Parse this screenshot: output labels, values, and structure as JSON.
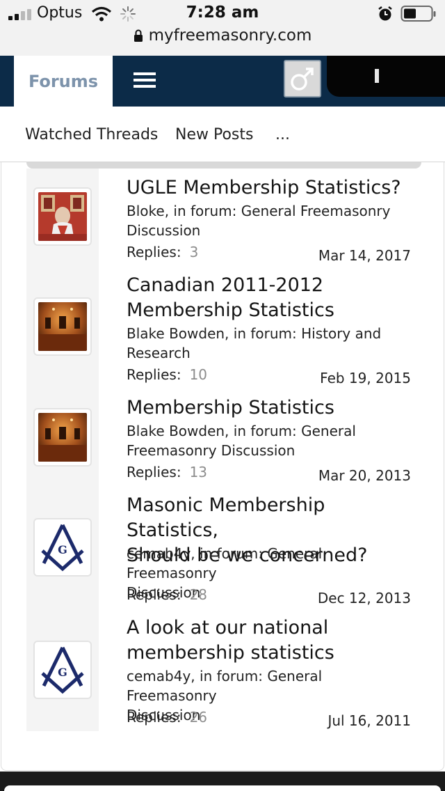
{
  "status_bar": {
    "carrier": "Optus",
    "time": "7:28 am",
    "url": "myfreemasonry.com"
  },
  "navbar": {
    "forums_tab": "Forums",
    "menu_icon": "hamburger-icon",
    "avatar_icon": "male-symbol-icon"
  },
  "subnav": {
    "items": [
      "Watched Threads",
      "New Posts",
      "..."
    ]
  },
  "results": [
    {
      "title_lines": [
        "UGLE Membership Statistics?"
      ],
      "meta_lines": [
        "Bloke, in forum: General Freemasonry",
        "Discussion"
      ],
      "replies_label": "Replies:",
      "replies": "3",
      "date": "Mar 14, 2017",
      "thumb": "red-portrait-avatar"
    },
    {
      "title_lines": [
        "Canadian 2011-2012",
        "Membership Statistics"
      ],
      "meta_lines": [
        "Blake Bowden, in forum: History and",
        "Research"
      ],
      "replies_label": "Replies:",
      "replies": "10",
      "date": "Feb 19, 2015",
      "thumb": "lodge-room-avatar"
    },
    {
      "title_lines": [
        "Membership Statistics"
      ],
      "meta_lines": [
        "Blake Bowden, in forum: General",
        "Freemasonry Discussion"
      ],
      "replies_label": "Replies:",
      "replies": "13",
      "date": "Mar 20, 2013",
      "thumb": "lodge-room-avatar"
    },
    {
      "title_lines": [
        "Masonic Membership Statistics,",
        "Should be we concerned?"
      ],
      "meta_lines": [
        "cemab4y, in forum: General Freemasonry",
        "Discussion"
      ],
      "replies_label": "Replies:",
      "replies": "28",
      "date": "Dec 12, 2013",
      "thumb": "square-compass-avatar"
    },
    {
      "title_lines": [
        "A look at our national",
        "membership statistics"
      ],
      "meta_lines": [
        "cemab4y, in forum: General Freemasonry",
        "Discussion"
      ],
      "replies_label": "Replies:",
      "replies": "26",
      "date": "Jul 16, 2011",
      "thumb": "square-compass-avatar"
    }
  ],
  "colors": {
    "navbar": "#0c2b48",
    "forums_tab_text": "#7d93ab",
    "replies_count": "#8c8c8c"
  }
}
